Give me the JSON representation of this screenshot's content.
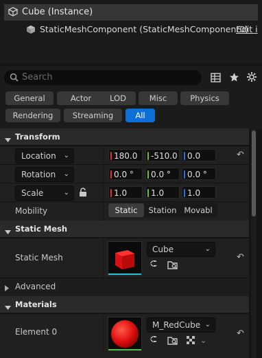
{
  "tree": {
    "root_label": "Cube (Instance)",
    "component_label": "StaticMeshComponent (StaticMeshComponent0)",
    "edit_label": "Edit i"
  },
  "search": {
    "placeholder": "Search"
  },
  "filters": [
    "General",
    "Actor",
    "LOD",
    "Misc",
    "Physics",
    "Rendering",
    "Streaming",
    "All"
  ],
  "filters_active": "All",
  "transform": {
    "title": "Transform",
    "location": {
      "label": "Location",
      "x": "180.0",
      "y": "-510.0",
      "z": "0.0"
    },
    "rotation": {
      "label": "Rotation",
      "x": "0.0 °",
      "y": "0.0 °",
      "z": "0.0 °"
    },
    "scale": {
      "label": "Scale",
      "x": "1.0",
      "y": "1.0",
      "z": "1.0"
    },
    "mobility": {
      "label": "Mobility",
      "options": [
        "Static",
        "Station",
        "Movabl"
      ],
      "selected": "Static"
    }
  },
  "static_mesh": {
    "title": "Static Mesh",
    "prop_label": "Static Mesh",
    "asset": "Cube"
  },
  "advanced": {
    "label": "Advanced"
  },
  "materials": {
    "title": "Materials",
    "element_label": "Element 0",
    "asset": "M_RedCube"
  },
  "colors": {
    "accent": "#0e70d6",
    "axis_x": "#e0312e",
    "axis_y": "#6dbf2c",
    "axis_z": "#2f6fe0",
    "mesh_underline": "#20c4d8",
    "material_underline": "#4cbf45"
  }
}
